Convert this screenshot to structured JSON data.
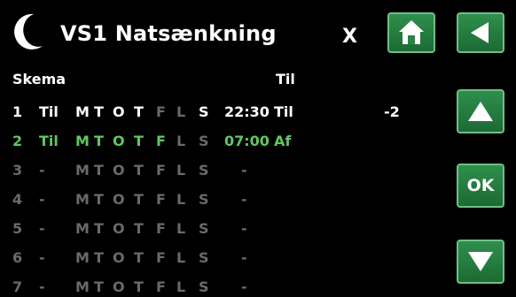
{
  "header": {
    "title": "VS1 Natsænkning",
    "close_label": "X"
  },
  "columns": {
    "schedule": "Skema",
    "action": "Til"
  },
  "rows": [
    {
      "num": "1",
      "mode": "Til",
      "days": [
        "M",
        "T",
        "O",
        "T",
        "F",
        "L",
        "S"
      ],
      "time": "22:30",
      "action": "Til",
      "value": "-2",
      "state": "active"
    },
    {
      "num": "2",
      "mode": "Til",
      "days": [
        "M",
        "T",
        "O",
        "T",
        "F",
        "L",
        "S"
      ],
      "time": "07:00",
      "action": "Af",
      "value": "",
      "state": "selected"
    },
    {
      "num": "3",
      "mode": "-",
      "days": [
        "M",
        "T",
        "O",
        "T",
        "F",
        "L",
        "S"
      ],
      "time": "-",
      "action": "",
      "value": "",
      "state": "empty"
    },
    {
      "num": "4",
      "mode": "-",
      "days": [
        "M",
        "T",
        "O",
        "T",
        "F",
        "L",
        "S"
      ],
      "time": "-",
      "action": "",
      "value": "",
      "state": "empty"
    },
    {
      "num": "5",
      "mode": "-",
      "days": [
        "M",
        "T",
        "O",
        "T",
        "F",
        "L",
        "S"
      ],
      "time": "-",
      "action": "",
      "value": "",
      "state": "empty"
    },
    {
      "num": "6",
      "mode": "-",
      "days": [
        "M",
        "T",
        "O",
        "T",
        "F",
        "L",
        "S"
      ],
      "time": "-",
      "action": "",
      "value": "",
      "state": "empty"
    },
    {
      "num": "7",
      "mode": "-",
      "days": [
        "M",
        "T",
        "O",
        "T",
        "F",
        "L",
        "S"
      ],
      "time": "-",
      "action": "",
      "value": "",
      "state": "empty"
    }
  ],
  "buttons": {
    "ok_label": "OK",
    "home_icon": "home-icon",
    "back_icon": "back-arrow-icon",
    "up_icon": "arrow-up-icon",
    "down_icon": "arrow-down-icon"
  },
  "colors": {
    "button_green": "#2f8f4c",
    "selected_row": "#5fc85f",
    "inactive_text": "#6a6a6a"
  }
}
